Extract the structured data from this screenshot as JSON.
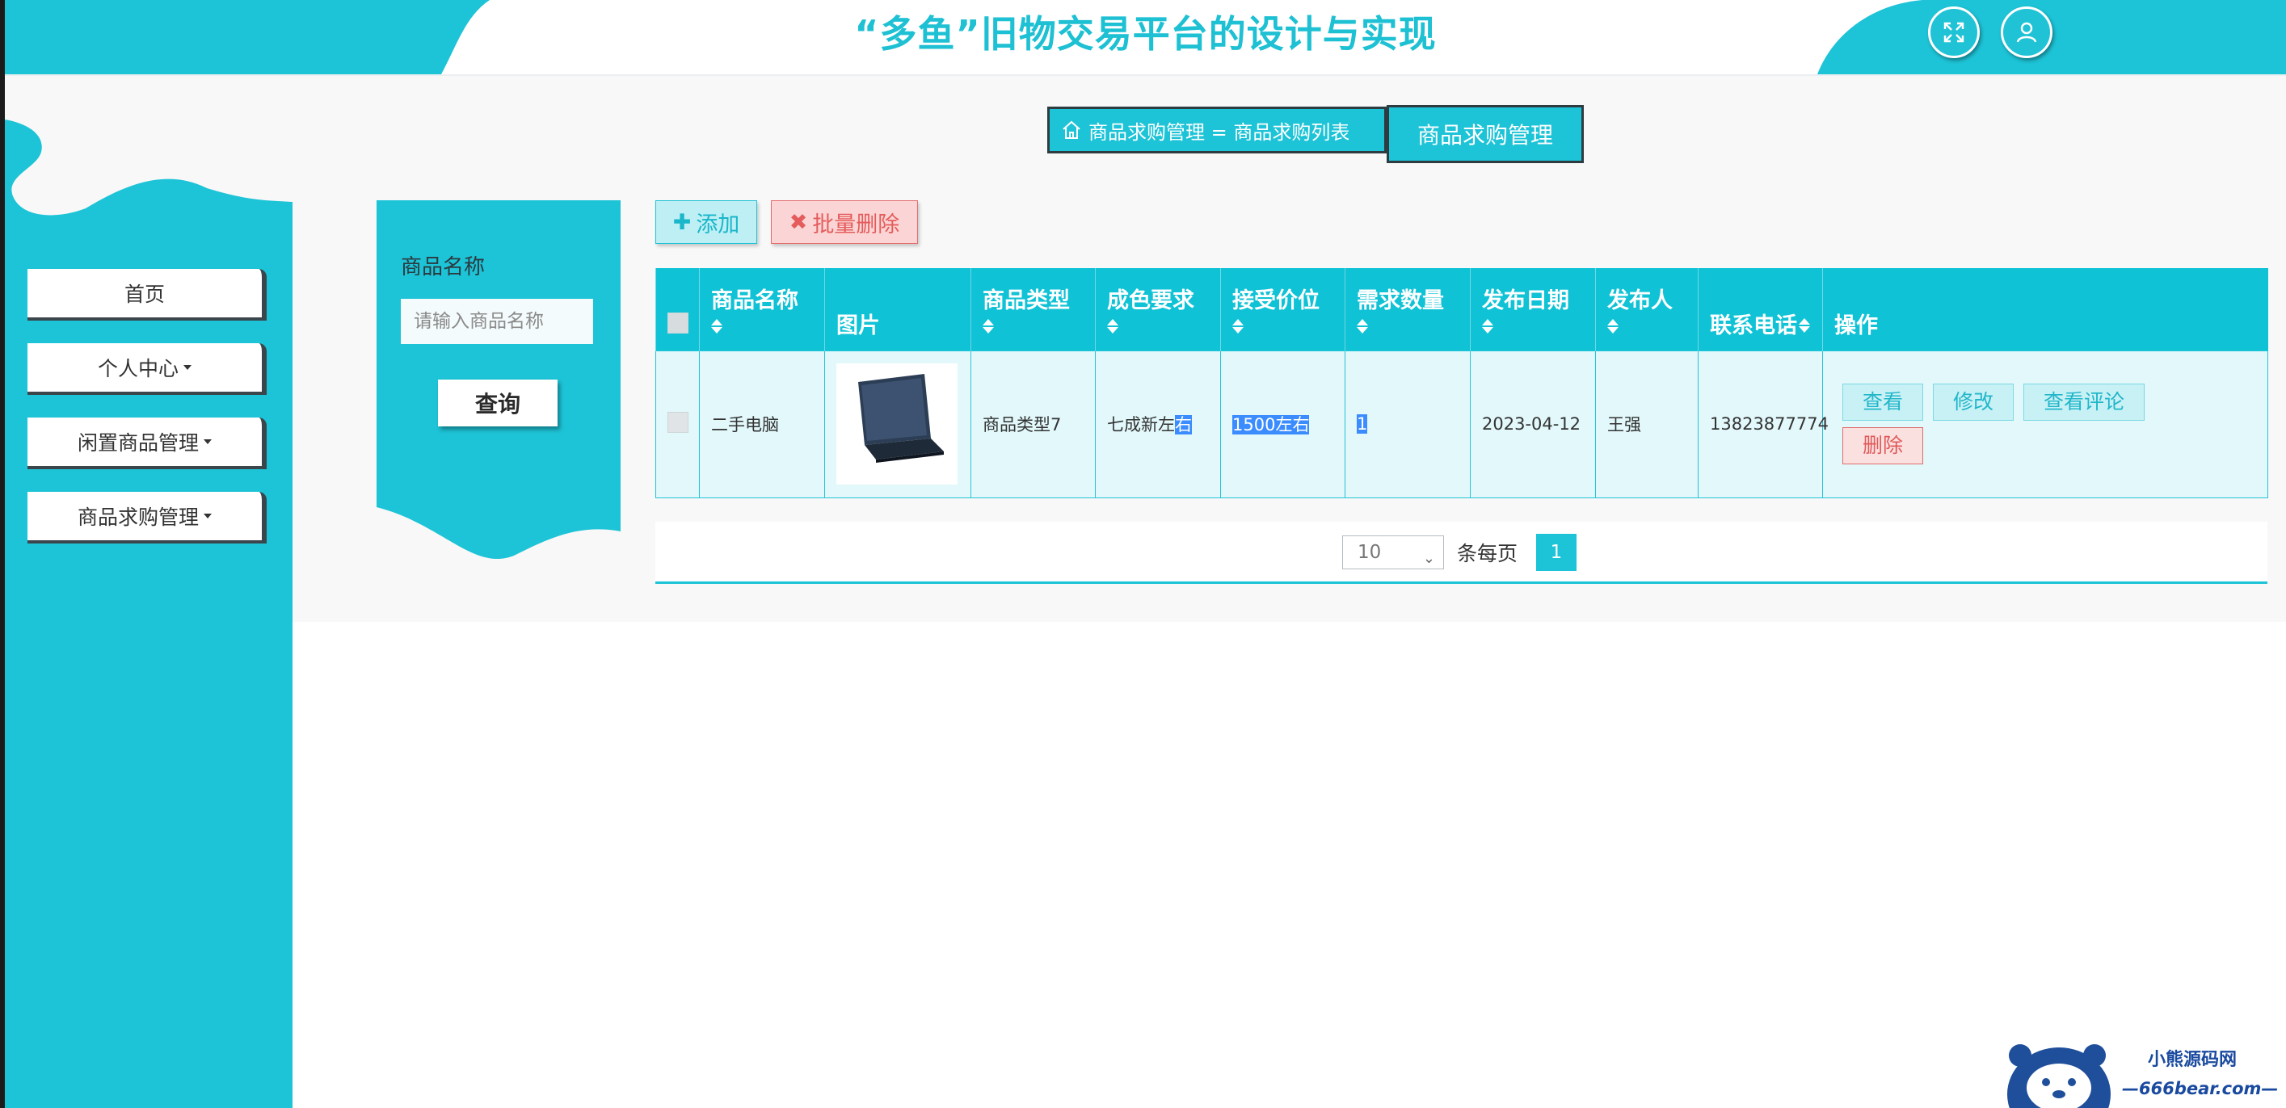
{
  "header": {
    "app_title": "“多鱼”旧物交易平台的设计与实现",
    "icons": [
      "fullscreen-icon",
      "user-icon"
    ],
    "accent_color": "#1dc3d6"
  },
  "breadcrumb": {
    "path": "商品求购管理 = 商品求购列表",
    "current": "商品求购管理"
  },
  "sidebar": {
    "items": [
      {
        "label": "首页",
        "has_caret": false
      },
      {
        "label": "个人中心",
        "has_caret": true
      },
      {
        "label": "闲置商品管理",
        "has_caret": true
      },
      {
        "label": "商品求购管理",
        "has_caret": true
      }
    ]
  },
  "search": {
    "label": "商品名称",
    "placeholder": "请输入商品名称",
    "button": "查询"
  },
  "actions": {
    "add": "添加",
    "batch_delete": "批量删除"
  },
  "table": {
    "columns": [
      "商品名称",
      "图片",
      "商品类型",
      "成色要求",
      "接受价位",
      "需求数量",
      "发布日期",
      "发布人",
      "联系电话",
      "操作"
    ],
    "rows": [
      {
        "name": "二手电脑",
        "image": "laptop-image",
        "type": "商品类型7",
        "condition_pre": "七成新左",
        "condition_sel": "右",
        "price": "1500左右",
        "quantity": "1",
        "date": "2023-04-12",
        "publisher": "王强",
        "phone": "13823877774",
        "ops": {
          "view": "查看",
          "edit": "修改",
          "view_comments": "查看评论",
          "delete": "删除"
        }
      }
    ]
  },
  "pagination": {
    "page_size": "10",
    "per_page_label": "条每页",
    "current_page": "1"
  },
  "watermark": {
    "line1": "小熊源码网",
    "line2": "—666bear.com—"
  }
}
